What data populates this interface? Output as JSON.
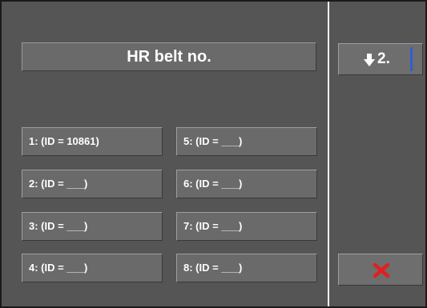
{
  "header": {
    "title": "HR belt no."
  },
  "belts": [
    {
      "label": "1: (ID = 10861)"
    },
    {
      "label": "2: (ID = ___)"
    },
    {
      "label": "3: (ID = ___)"
    },
    {
      "label": "4: (ID = ___)"
    },
    {
      "label": "5: (ID = ___)"
    },
    {
      "label": "6: (ID = ___)"
    },
    {
      "label": "7: (ID = ___)"
    },
    {
      "label": "8: (ID = ___)"
    }
  ],
  "side": {
    "page_button": {
      "label": "2.",
      "icon": "arrow-down-icon"
    },
    "cancel_button": {
      "icon": "close-icon",
      "color": "#e02020"
    }
  },
  "colors": {
    "background": "#555555",
    "button": "#6a6a6a",
    "text": "#ffffff",
    "accent": "#2f5fd0"
  }
}
